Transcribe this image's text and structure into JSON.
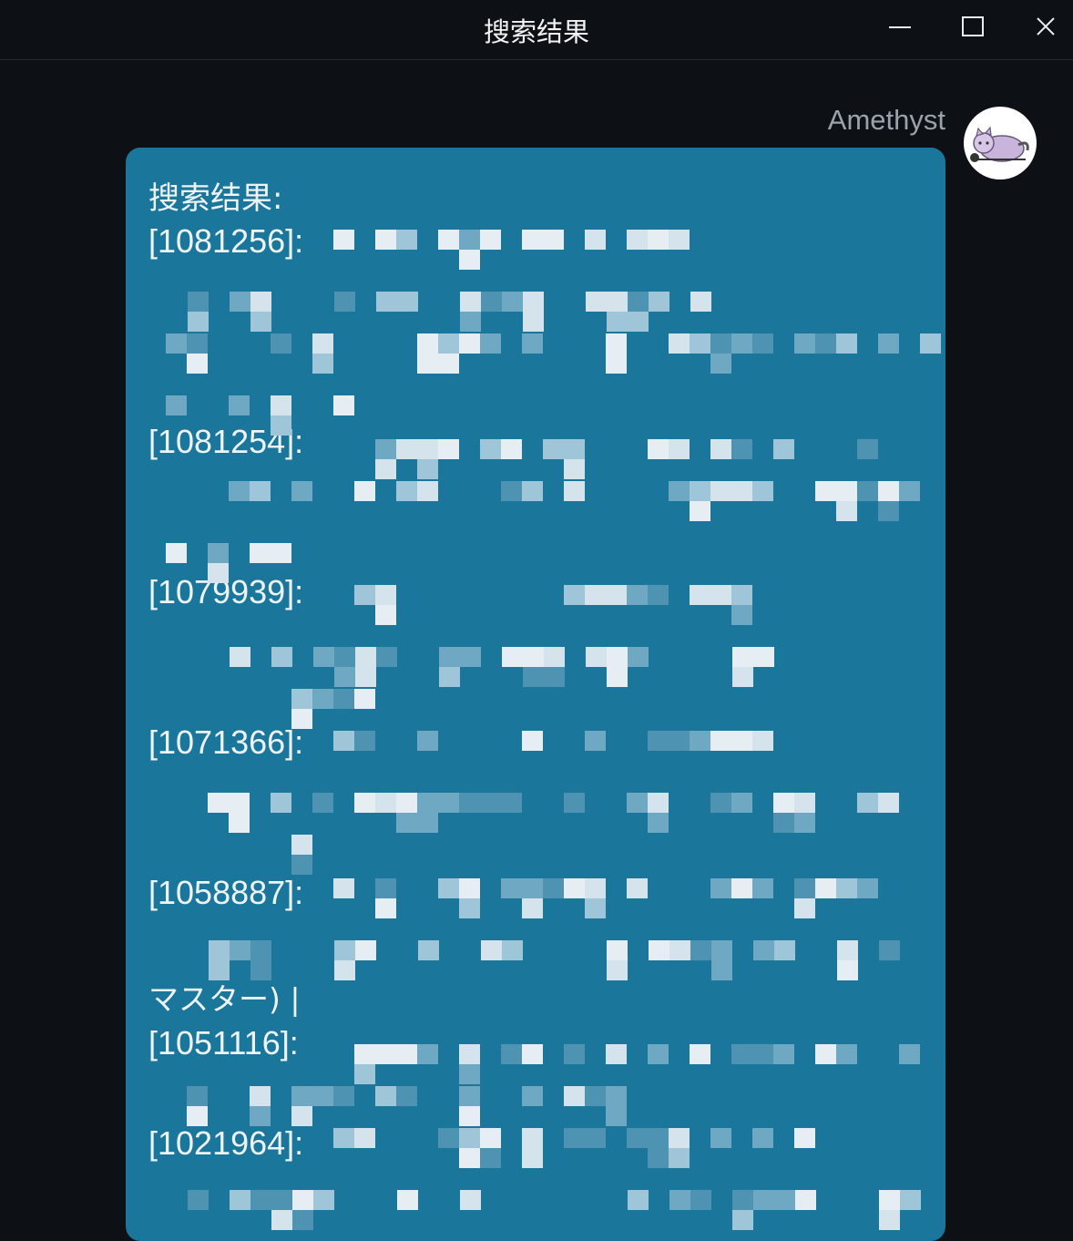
{
  "window": {
    "title": "搜索结果",
    "minimize_icon": "minimize-icon",
    "maximize_icon": "maximize-icon",
    "close_icon": "close-icon"
  },
  "message": {
    "sender": "Amethyst",
    "heading": "搜索结果:",
    "results": [
      {
        "id": "[1081256]:"
      },
      {
        "id": "[1081254]:"
      },
      {
        "id": "[1079939]:"
      },
      {
        "id": "[1071366]:"
      },
      {
        "id": "[1058887]:"
      },
      {
        "id": "[1051116]:"
      },
      {
        "id": "[1021964]:"
      }
    ],
    "visible_snippet": "マスター) |"
  },
  "colors": {
    "background": "#0d1116",
    "bubble": "#1b769c",
    "text": "#eef3f6",
    "sender_name": "#9aa2aa"
  }
}
